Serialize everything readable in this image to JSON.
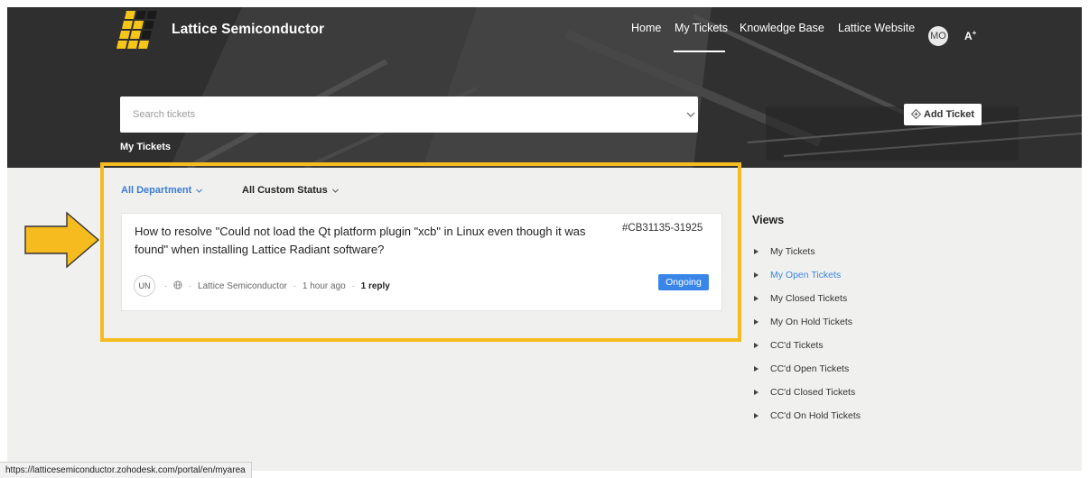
{
  "header": {
    "brand": "Lattice Semiconductor",
    "nav": [
      {
        "label": "Home"
      },
      {
        "label": "My Tickets"
      },
      {
        "label": "Knowledge Base"
      },
      {
        "label": "Lattice Website"
      }
    ],
    "active_nav": "My Tickets",
    "avatar_initials": "MO",
    "accessibility_label": "A"
  },
  "search": {
    "placeholder": "Search tickets"
  },
  "add_ticket_label": "Add Ticket",
  "breadcrumb": "My Tickets",
  "filters": {
    "department": "All Department",
    "status": "All Custom Status"
  },
  "ticket": {
    "title": "How to resolve \"Could not load the Qt platform plugin \"xcb\" in Linux even though it was found\" when installing Lattice Radiant software?",
    "id": "#CB31135-31925",
    "avatar_initials": "UN",
    "channel_icon": "globe-icon",
    "department": "Lattice Semiconductor",
    "time": "1 hour ago",
    "replies": "1 reply",
    "status": "Ongoing"
  },
  "views": {
    "title": "Views",
    "items": [
      {
        "label": "My Tickets"
      },
      {
        "label": "My Open Tickets"
      },
      {
        "label": "My Closed Tickets"
      },
      {
        "label": "My On Hold Tickets"
      },
      {
        "label": "CC'd Tickets"
      },
      {
        "label": "CC'd Open Tickets"
      },
      {
        "label": "CC'd Closed Tickets"
      },
      {
        "label": "CC'd On Hold Tickets"
      }
    ],
    "active": "My Open Tickets"
  },
  "status_bar_url": "https://latticesemiconductor.zohodesk.com/portal/en/myarea",
  "colors": {
    "accent": "#3a86e8",
    "highlight": "#f6bb1f",
    "logo_yellow": "#f5c518"
  }
}
